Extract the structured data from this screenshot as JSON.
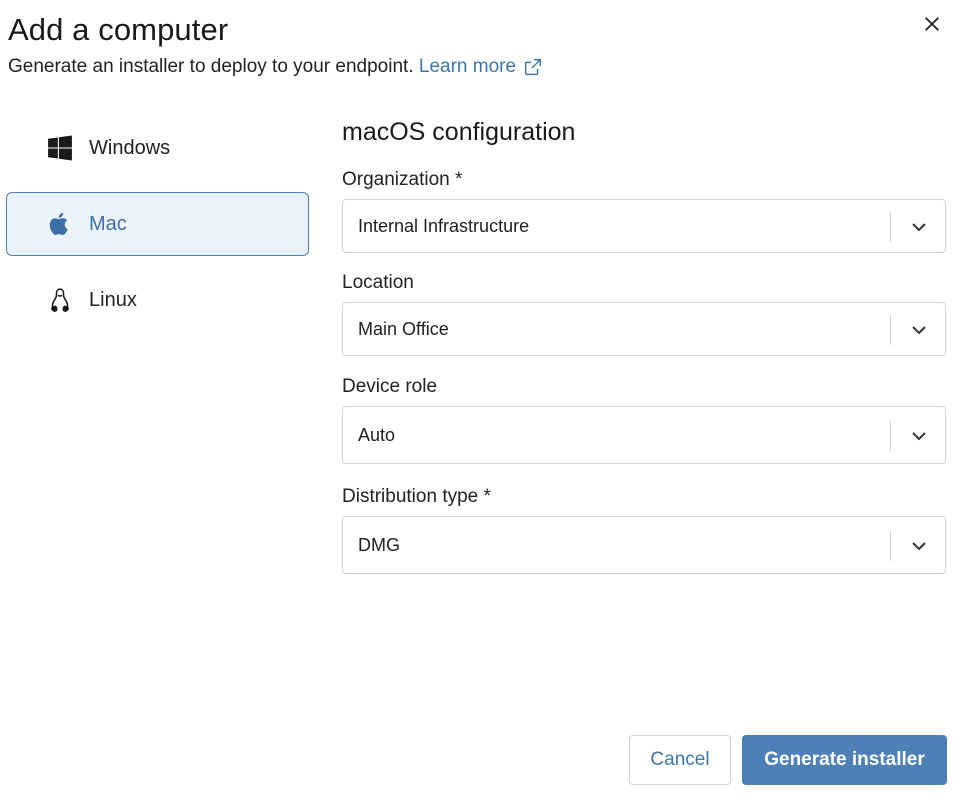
{
  "dialog": {
    "title": "Add a computer",
    "subtitle": "Generate an installer to deploy to your endpoint.",
    "learn_more": "Learn more",
    "close_icon": "close-icon"
  },
  "os_options": [
    {
      "label": "Windows",
      "icon": "windows-icon",
      "selected": false
    },
    {
      "label": "Mac",
      "icon": "apple-icon",
      "selected": true
    },
    {
      "label": "Linux",
      "icon": "linux-icon",
      "selected": false
    }
  ],
  "form": {
    "title": "macOS configuration",
    "fields": [
      {
        "label": "Organization *",
        "value": "Internal Infrastructure"
      },
      {
        "label": "Location",
        "value": "Main Office"
      },
      {
        "label": "Device role",
        "value": "Auto"
      },
      {
        "label": "Distribution type *",
        "value": "DMG"
      }
    ]
  },
  "footer": {
    "cancel": "Cancel",
    "generate": "Generate installer"
  },
  "colors": {
    "accent": "#4d80b6",
    "link": "#3d76ad",
    "selected_bg": "#eaf2fb"
  }
}
